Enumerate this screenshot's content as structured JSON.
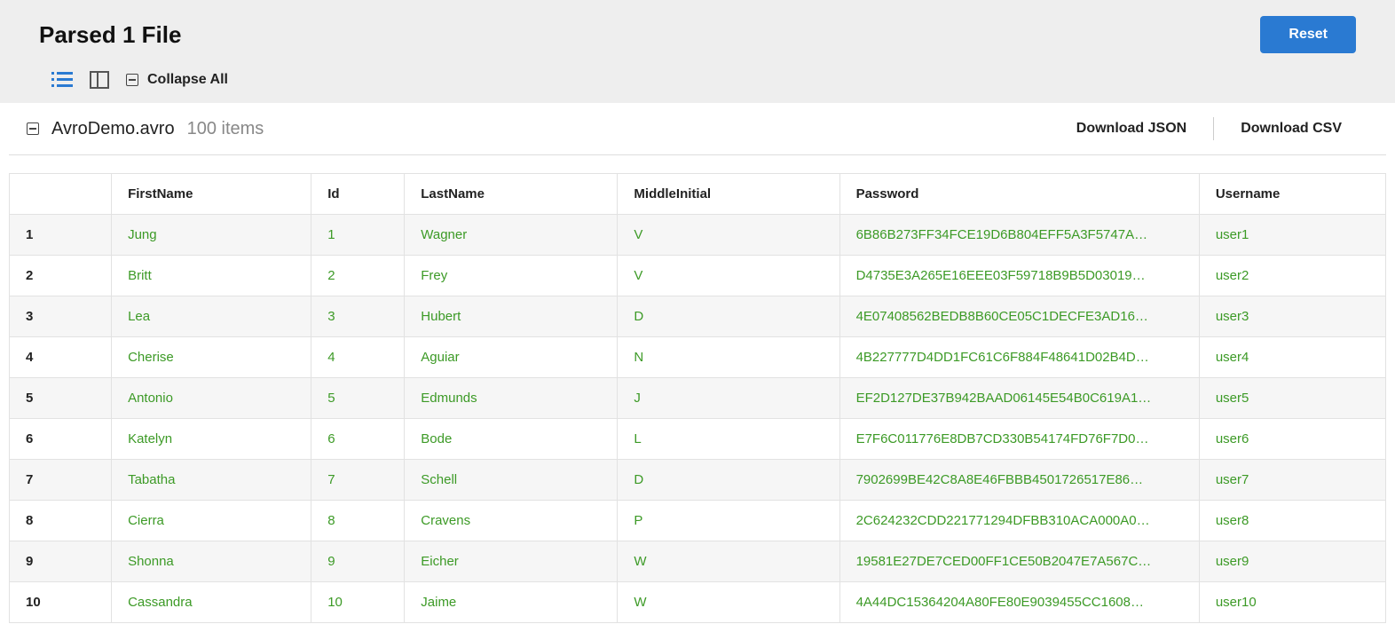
{
  "header": {
    "title": "Parsed 1 File",
    "reset_label": "Reset",
    "collapse_all_label": "Collapse All"
  },
  "file": {
    "name": "AvroDemo.avro",
    "items_label": "100 items"
  },
  "actions": {
    "download_json": "Download JSON",
    "download_csv": "Download CSV"
  },
  "table": {
    "columns": [
      "FirstName",
      "Id",
      "LastName",
      "MiddleInitial",
      "Password",
      "Username"
    ],
    "rows": [
      {
        "idx": "1",
        "FirstName": "Jung",
        "Id": "1",
        "LastName": "Wagner",
        "MiddleInitial": "V",
        "Password": "6B86B273FF34FCE19D6B804EFF5A3F5747A…",
        "Username": "user1"
      },
      {
        "idx": "2",
        "FirstName": "Britt",
        "Id": "2",
        "LastName": "Frey",
        "MiddleInitial": "V",
        "Password": "D4735E3A265E16EEE03F59718B9B5D03019…",
        "Username": "user2"
      },
      {
        "idx": "3",
        "FirstName": "Lea",
        "Id": "3",
        "LastName": "Hubert",
        "MiddleInitial": "D",
        "Password": "4E07408562BEDB8B60CE05C1DECFE3AD16…",
        "Username": "user3"
      },
      {
        "idx": "4",
        "FirstName": "Cherise",
        "Id": "4",
        "LastName": "Aguiar",
        "MiddleInitial": "N",
        "Password": "4B227777D4DD1FC61C6F884F48641D02B4D…",
        "Username": "user4"
      },
      {
        "idx": "5",
        "FirstName": "Antonio",
        "Id": "5",
        "LastName": "Edmunds",
        "MiddleInitial": "J",
        "Password": "EF2D127DE37B942BAAD06145E54B0C619A1…",
        "Username": "user5"
      },
      {
        "idx": "6",
        "FirstName": "Katelyn",
        "Id": "6",
        "LastName": "Bode",
        "MiddleInitial": "L",
        "Password": "E7F6C011776E8DB7CD330B54174FD76F7D0…",
        "Username": "user6"
      },
      {
        "idx": "7",
        "FirstName": "Tabatha",
        "Id": "7",
        "LastName": "Schell",
        "MiddleInitial": "D",
        "Password": "7902699BE42C8A8E46FBBB4501726517E86…",
        "Username": "user7"
      },
      {
        "idx": "8",
        "FirstName": "Cierra",
        "Id": "8",
        "LastName": "Cravens",
        "MiddleInitial": "P",
        "Password": "2C624232CDD221771294DFBB310ACA000A0…",
        "Username": "user8"
      },
      {
        "idx": "9",
        "FirstName": "Shonna",
        "Id": "9",
        "LastName": "Eicher",
        "MiddleInitial": "W",
        "Password": "19581E27DE7CED00FF1CE50B2047E7A567C…",
        "Username": "user9"
      },
      {
        "idx": "10",
        "FirstName": "Cassandra",
        "Id": "10",
        "LastName": "Jaime",
        "MiddleInitial": "W",
        "Password": "4A44DC15364204A80FE80E9039455CC1608…",
        "Username": "user10"
      }
    ]
  }
}
